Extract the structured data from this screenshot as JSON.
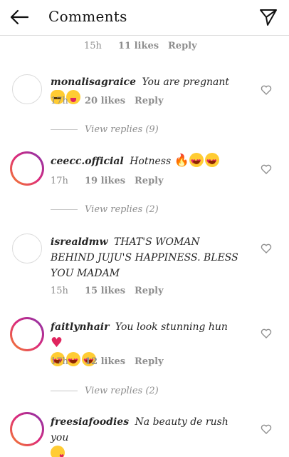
{
  "header": {
    "title": "Comments",
    "back_icon": "back-arrow-icon",
    "send_icon": "paper-plane-icon"
  },
  "top_meta": {
    "time": "15h",
    "likes": "11 likes",
    "reply": "Reply"
  },
  "comments": [
    {
      "username": "monalisagraice",
      "text": "You are pregnant",
      "emojis": [
        "crying-cat-emoji",
        "tongue-out-emoji"
      ],
      "time": "17h",
      "likes": "20 likes",
      "reply": "Reply",
      "view_replies": "View replies (9)",
      "has_story": false
    },
    {
      "username": "ceecc.official",
      "text": "Hotness",
      "emojis": [
        "fire-emoji",
        "heart-eyes-emoji",
        "heart-eyes-emoji"
      ],
      "time": "17h",
      "likes": "19 likes",
      "reply": "Reply",
      "view_replies": "View replies (2)",
      "has_story": true
    },
    {
      "username": "isrealdmw",
      "text": "THAT'S WOMAN BEHIND JUJU'S HAPPINESS. BLESS YOU MADAM",
      "emojis": [],
      "time": "15h",
      "likes": "15 likes",
      "reply": "Reply",
      "view_replies": "",
      "has_story": false
    },
    {
      "username": "faitlynhair",
      "text": "You look stunning hun",
      "emojis": [
        "red-heart-emoji",
        "heart-eyes-emoji",
        "heart-eyes-emoji",
        "heart-eyes-emoji"
      ],
      "time": "17h",
      "likes": "12 likes",
      "reply": "Reply",
      "view_replies": "View replies (2)",
      "has_story": true
    },
    {
      "username": "freesiafoodies",
      "text": "Na beauty de rush you",
      "emojis": [
        "kissing-emoji"
      ],
      "time": "",
      "likes": "",
      "reply": "",
      "view_replies": "",
      "has_story": true
    }
  ],
  "colors": {
    "text": "#262626",
    "meta": "#8e8e8e",
    "divider": "#dbdbdb",
    "story_ring_start": "#f58529",
    "story_ring_end": "#8134af"
  }
}
